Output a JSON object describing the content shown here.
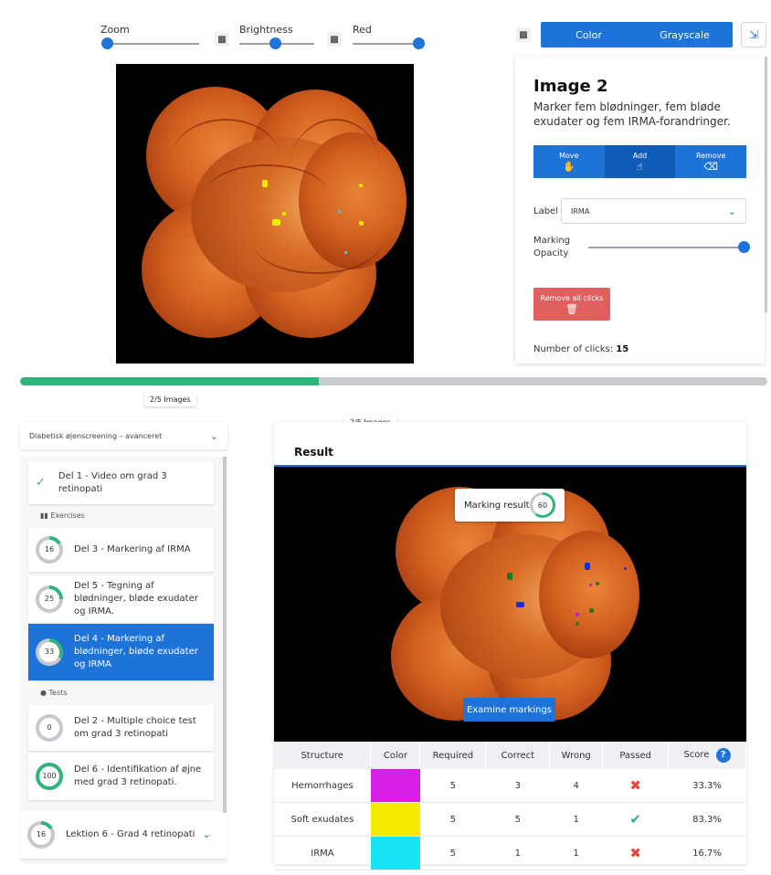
{
  "toolbar": {
    "zoom_label": "Zoom",
    "brightness_label": "Brightness",
    "red_label": "Red",
    "mode_tabs": [
      "Color",
      "Grayscale"
    ]
  },
  "panel": {
    "title": "Image 2",
    "description": "Marker fem blødninger, fem bløde exudater og fem IRMA-forandringer.",
    "modes": [
      {
        "label": "Move",
        "icon": "hand-icon"
      },
      {
        "label": "Add",
        "icon": "pointer-icon"
      },
      {
        "label": "Remove",
        "icon": "eraser-icon"
      }
    ],
    "label_caption": "Label",
    "label_value": "IRMA",
    "opacity_caption": "Marking Opacity",
    "remove_all": "Remove all clicks",
    "clicks_caption": "Number of clicks:",
    "clicks_value": "15"
  },
  "progress": {
    "fraction": 0.4,
    "label": "2/5 Images",
    "label2": "2/5 Images"
  },
  "course": {
    "select_value": "Diabetisk øjenscreening – avanceret",
    "completed_item": "Del 1 - Video om grad 3 retinopati",
    "exercises_label": "Exercises",
    "tests_label": "Tests",
    "exercises": [
      {
        "score": "16",
        "title": "Del 3 - Markering af IRMA"
      },
      {
        "score": "25",
        "title": "Del 5 - Tegning af blødninger, bløde exudater og IRMA."
      },
      {
        "score": "33",
        "title": "Del 4 - Markering af blødninger, bløde exudater og IRMA"
      }
    ],
    "tests": [
      {
        "score": "0",
        "title": "Del 2 - Multiple choice test om grad 3 retinopati"
      },
      {
        "score": "100",
        "title": "Del 6 - Identifikation af øjne med grad 3 retinopati."
      }
    ],
    "next_lesson": {
      "score": "16",
      "title": "Lektion 6 - Grad 4 retinopati"
    }
  },
  "result": {
    "title": "Result",
    "marking_result_label": "Marking result",
    "marking_result_value": "60",
    "examine_button": "Examine markings",
    "headers": [
      "Structure",
      "Color",
      "Required",
      "Correct",
      "Wrong",
      "Passed",
      "Score"
    ],
    "rows": [
      {
        "structure": "Hemorrhages",
        "color": "#d81fe6",
        "required": "5",
        "correct": "3",
        "wrong": "4",
        "passed": false,
        "score": "33.3%"
      },
      {
        "structure": "Soft exudates",
        "color": "#f5ea00",
        "required": "5",
        "correct": "5",
        "wrong": "1",
        "passed": true,
        "score": "83.3%"
      },
      {
        "structure": "IRMA",
        "color": "#17e4f5",
        "required": "5",
        "correct": "1",
        "wrong": "1",
        "passed": false,
        "score": "16.7%"
      }
    ]
  },
  "colors": {
    "accent": "#1e73d8",
    "progress": "#2fb47c",
    "danger": "#e06060"
  }
}
